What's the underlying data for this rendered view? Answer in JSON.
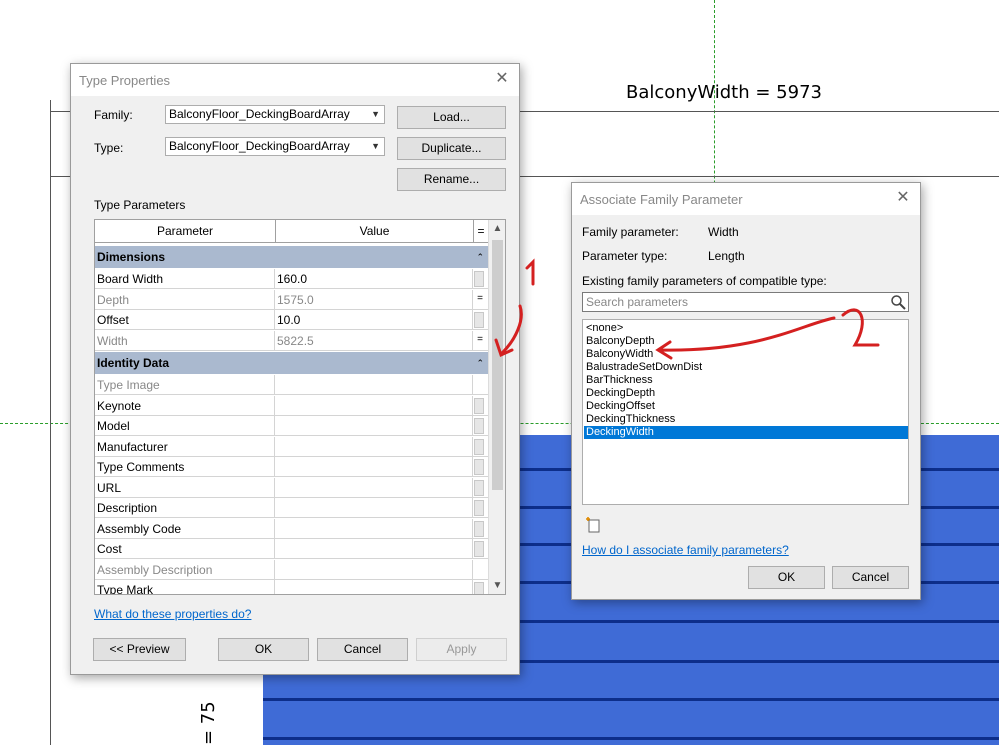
{
  "canvas": {
    "dimension_label": "BalconyWidth = 5973",
    "vertical_label": "= 75"
  },
  "type_properties": {
    "title": "Type Properties",
    "family_label": "Family:",
    "family_value": "BalconyFloor_DeckingBoardArray",
    "type_label": "Type:",
    "type_value": "BalconyFloor_DeckingBoardArray",
    "load_button": "Load...",
    "duplicate_button": "Duplicate...",
    "rename_button": "Rename...",
    "section_label": "Type Parameters",
    "table": {
      "col_parameter": "Parameter",
      "col_value": "Value",
      "col_eq": "=",
      "group_dimensions": "Dimensions",
      "dimensions": [
        {
          "name": "Board Width",
          "value": "160.0",
          "greyed": false,
          "eq": ""
        },
        {
          "name": "Depth",
          "value": "1575.0",
          "greyed": true,
          "eq": "="
        },
        {
          "name": "Offset",
          "value": "10.0",
          "greyed": false,
          "eq": ""
        },
        {
          "name": "Width",
          "value": "5822.5",
          "greyed": true,
          "eq": "="
        }
      ],
      "group_identity": "Identity Data",
      "identity": [
        {
          "name": "Type Image",
          "greyed": true
        },
        {
          "name": "Keynote",
          "greyed": false
        },
        {
          "name": "Model",
          "greyed": false
        },
        {
          "name": "Manufacturer",
          "greyed": false
        },
        {
          "name": "Type Comments",
          "greyed": false
        },
        {
          "name": "URL",
          "greyed": false
        },
        {
          "name": "Description",
          "greyed": false
        },
        {
          "name": "Assembly Code",
          "greyed": false
        },
        {
          "name": "Cost",
          "greyed": false
        },
        {
          "name": "Assembly Description",
          "greyed": true
        },
        {
          "name": "Type Mark",
          "greyed": false
        }
      ]
    },
    "help_link": "What do these properties do?",
    "preview_button": "<< Preview",
    "ok_button": "OK",
    "cancel_button": "Cancel",
    "apply_button": "Apply"
  },
  "associate": {
    "title": "Associate Family Parameter",
    "family_param_label": "Family parameter:",
    "family_param_value": "Width",
    "param_type_label": "Parameter type:",
    "param_type_value": "Length",
    "existing_label": "Existing family parameters of compatible type:",
    "search_placeholder": "Search parameters",
    "params": [
      "<none>",
      "BalconyDepth",
      "BalconyWidth",
      "BalustradeSetDownDist",
      "BarThickness",
      "DeckingDepth",
      "DeckingOffset",
      "DeckingThickness",
      "DeckingWidth"
    ],
    "selected_index": 8,
    "help_link": "How do I associate family parameters?",
    "ok_button": "OK",
    "cancel_button": "Cancel"
  },
  "annotations": {
    "mark_1": "1",
    "mark_2": "2",
    "color": "#d42020"
  },
  "colors": {
    "deck_fill": "#3f6bd6",
    "selection": "#0078d7",
    "group_header": "#aab9cf"
  }
}
